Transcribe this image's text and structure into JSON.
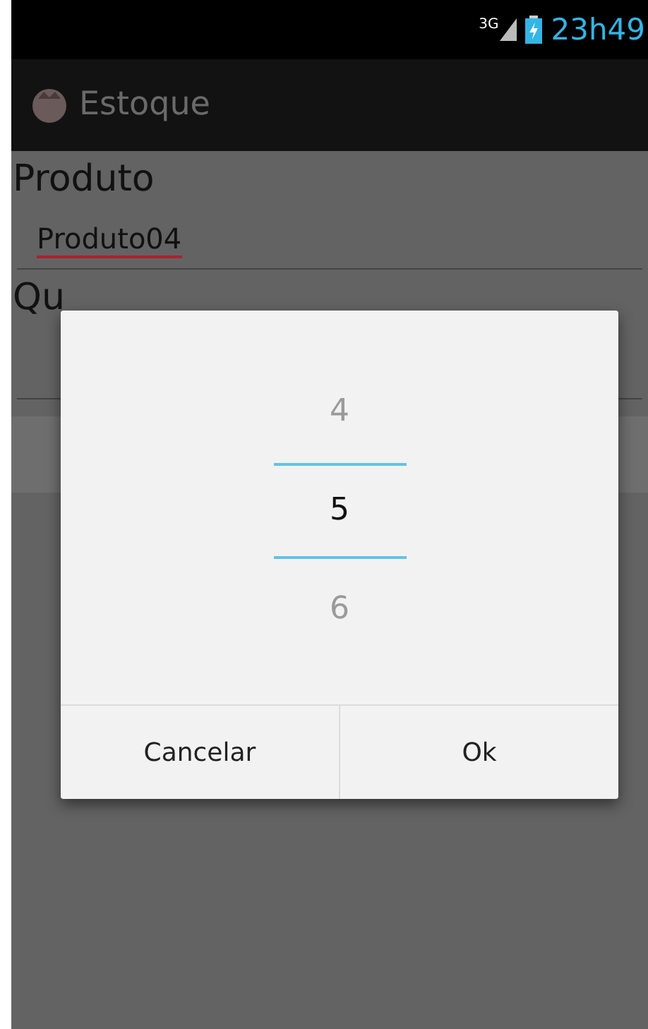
{
  "status_bar": {
    "network": "3G",
    "time": "23h49"
  },
  "action_bar": {
    "title": "Estoque"
  },
  "form": {
    "product_label": "Produto",
    "product_value": "Produto04",
    "quantity_label": "Qu"
  },
  "picker_dialog": {
    "values": [
      {
        "label": "4",
        "selected": false
      },
      {
        "label": "5",
        "selected": true
      },
      {
        "label": "6",
        "selected": false
      }
    ],
    "buttons": [
      "Cancelar",
      "Ok"
    ]
  }
}
